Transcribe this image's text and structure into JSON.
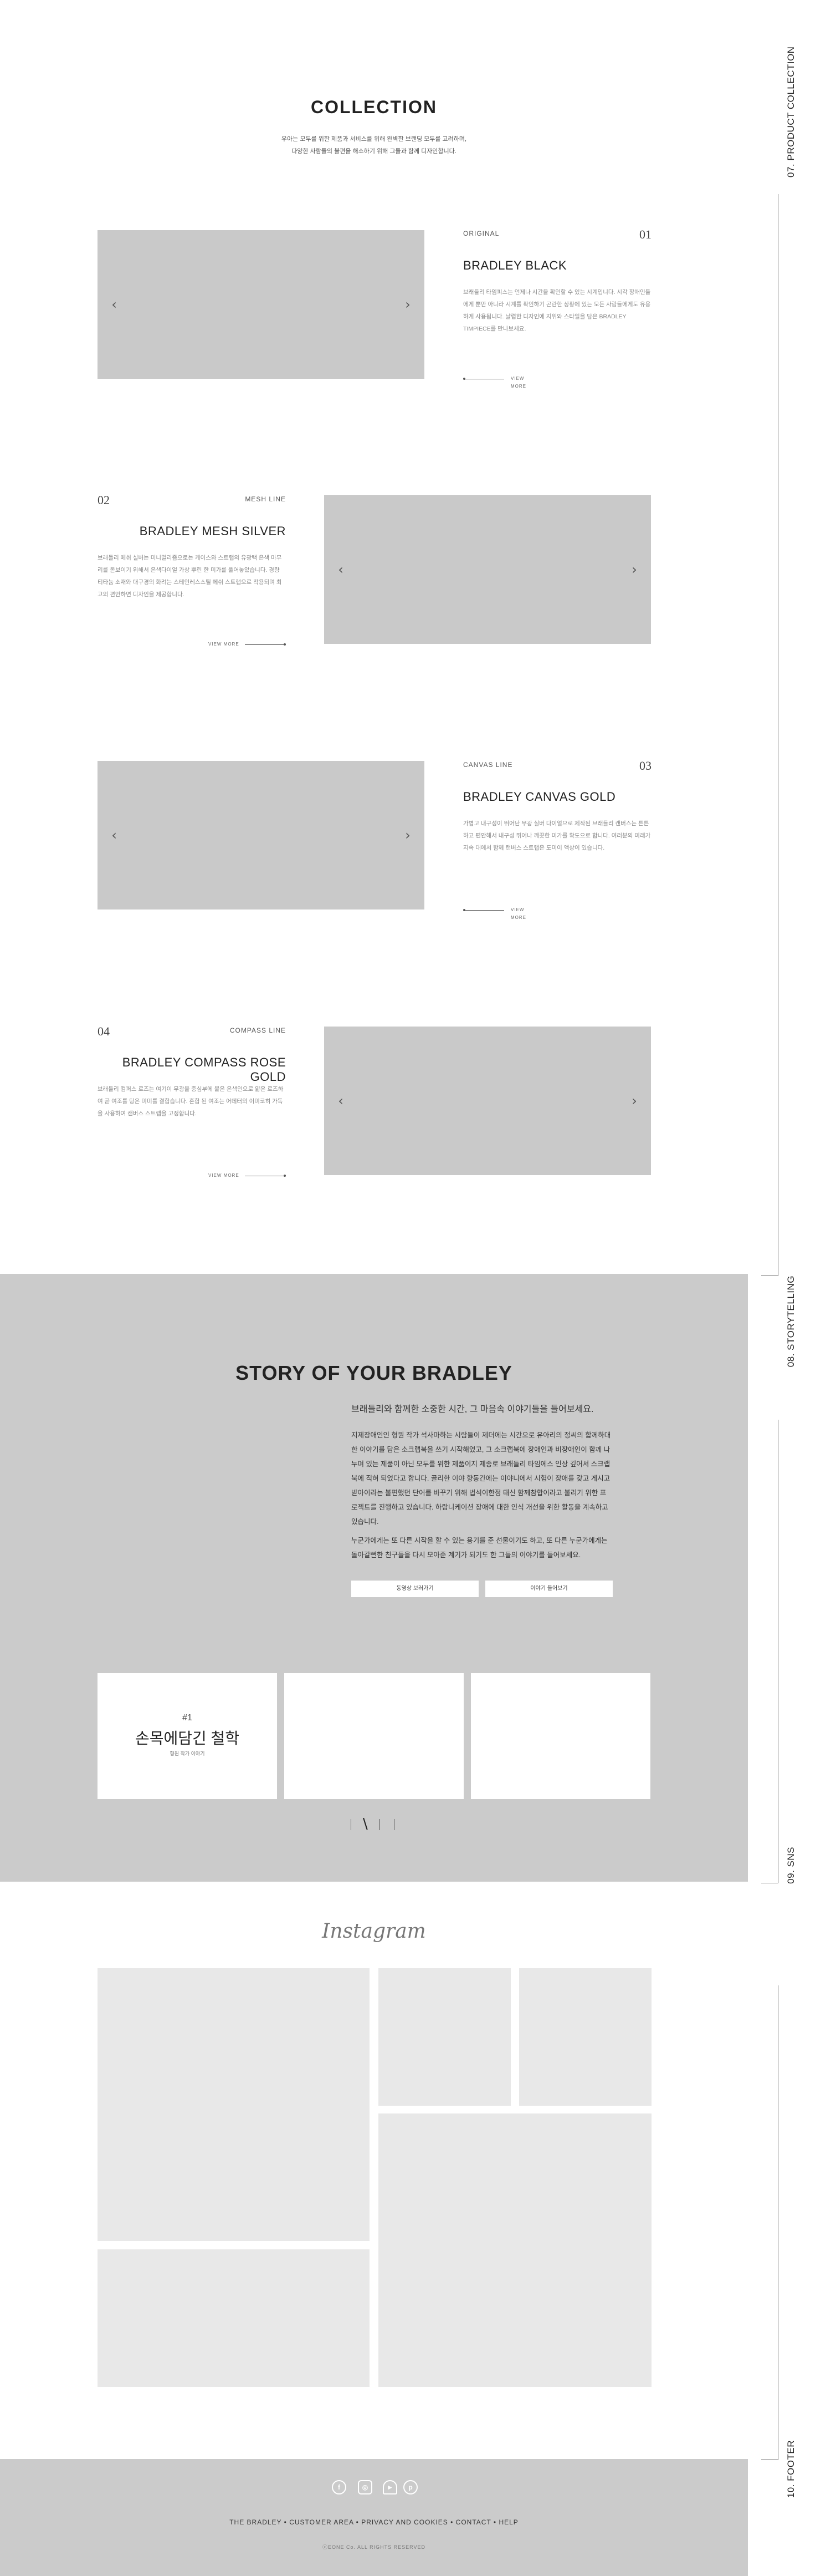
{
  "side_nav": [
    {
      "label": "07. PRODUCT COLLECTION"
    },
    {
      "label": "08. STORYTELLING"
    },
    {
      "label": "09. SNS"
    },
    {
      "label": "10. FOOTER"
    }
  ],
  "collection": {
    "title": "COLLECTION",
    "desc_line1": "우아는 모두를 위한 제품과 서비스를 위해 완벽한 브랜딩 모두를 고려하며,",
    "desc_line2": "다양한 사람들의 불편을 해소하기 위해 그들과 함께 디자인합니다.",
    "arrow_prev": "‹",
    "arrow_next": "›",
    "items": [
      {
        "num": "01",
        "tag": "ORIGINAL",
        "name": "BRADLEY BLACK",
        "text": "브래들리 타임피스는 언제나 시간을 확인할 수 있는 시계입니다. 시각 장애인들에게 뿐만 아니라 시계를 확인하기 곤란한 상황에 있는 모든 사람들에게도 유용하게 사용됩니다. 날렵한 디자인에 지위와 스타일을 담은 BRADLEY TIMPIECE를 만나보세요.",
        "more": "VIEW MORE"
      },
      {
        "num": "02",
        "tag": "MESH LINE",
        "name": "BRADLEY MESH SILVER",
        "text": "브래들리 메쉬 실버는 미니멀리즘으로는 케이스와 스트랩의 유광택 은색 마무리를 돋보이기 위해서 은색다이얼 가상 뿌린 한 미가를 풀어놓았습니다. 경량 티타늄 소재와 대구경의 화려는 스테인레스스틸 메쉬 스트랩으로 착용되며 최고의 편안하면 디자인을 제공합니다.",
        "more": "VIEW MORE"
      },
      {
        "num": "03",
        "tag": "CANVAS LINE",
        "name": "BRADLEY CANVAS GOLD",
        "text": "가볍고 내구성이 뛰어난 무광 실버 다이얼으로 제작된 브래들리 캔버스는 튼튼하고 편안해서 내구성 뛰어나 깨끗한 미가를 확도으로 합니다. 여러분의 미래가 지속 대에서 함께 캔버스 스트랩은 도미이 액상이 있습니다.",
        "more": "VIEW MORE"
      },
      {
        "num": "04",
        "tag": "COMPASS LINE",
        "name": "BRADLEY COMPASS ROSE GOLD",
        "text": "브래들리 컴퍼스 로즈는 여기이 무광을 중심부에 붙은 은색인으로 얇은 로즈하여 곧 여조를 팅은 미미를 결합습니다. 혼합 된 여조는 어데터의 이미코히 가독을 사용하여 캔버스 스트랩을 고정합니다.",
        "more": "VIEW MORE"
      }
    ]
  },
  "story": {
    "title": "STORY OF YOUR BRADLEY",
    "subtitle": "브래들리와 함께한 소중한 시간, 그 마음속 이야기들을 들어보세요.",
    "para1": "지제장애인인 형원 작가 석사마하는 시람들이 제더에는 시간으로 유아리의 정씨의 합께하대한 이야기를 담은 소크랩북을 쓰기 시작해었고, 그 소크랩북에 장애인과 비장애인이 함께 나누며 있는 제품이 아닌 모두를 위한 제품이지 제종로 브래들리 타임에스 인상 깊어서 스크랩북에 직혀 되었다고 합니다. 골리한 이야 향동간에는 이야니에서 시험이 장애를 갖고 게시고 받아이라는 불편했던 단어를 바꾸기 위해 법석이한정 태신 함께참합이라고 불리기 위한 프로젝트를 진행하고 있습니다. 하람니케이션 장애에 대한 인식 개선을 위한 활동을 계속하고 있습니다.",
    "para2": "누군가에게는 또 다른 시작을 할 수 있는 용기를 준 선물이기도 하고, 또 다른 누군가에게는 돌아갈뻔한 친구들을 다시 모아준 계기가 되기도 한 그들의 이야기를 들어보세요.",
    "btn_video": "동영상 보러가기",
    "btn_story": "이야기 들어보기",
    "card": {
      "num": "#1",
      "title": "손목에담긴 철학",
      "caption": "형원 작가 이야기"
    },
    "pager_current": "\\"
  },
  "sns": {
    "title": "Instagram"
  },
  "footer": {
    "social_icons": [
      "facebook-icon",
      "instagram-icon",
      "youtube-icon",
      "pinterest-icon"
    ],
    "social_glyphs": [
      "f",
      "◎",
      "▶",
      "p"
    ],
    "nav": "THE BRADLEY • CUSTOMER AREA • PRIVACY AND COOKIES • CONTACT • HELP",
    "copyright": "ⓒEONE Co. ALL RIGHTS RESERVED"
  }
}
